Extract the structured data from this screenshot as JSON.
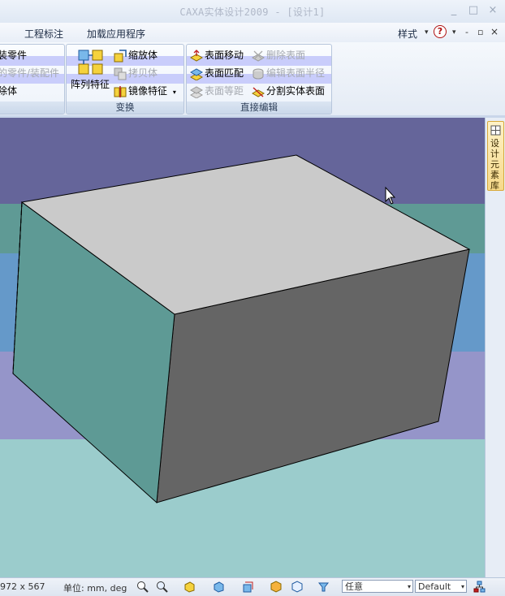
{
  "window": {
    "title": "CAXA实体设计2009 - [设计1]",
    "minimize": "_",
    "restore": "□",
    "close": "×"
  },
  "menu": {
    "tabs": [
      "工程标注",
      "加载应用程序"
    ],
    "style": "样式",
    "style_arrow": "▾",
    "help": "?",
    "help_arrow": "▾",
    "mdi_min": "-",
    "mdi_restore": "▫",
    "mdi_close": "×"
  },
  "ribbon": {
    "group1": {
      "items": [
        "装零件",
        "的零件/装配件",
        "除体"
      ]
    },
    "transform": {
      "label": "变换",
      "array_feature": "阵列特征",
      "scale_body": "缩放体",
      "copy_body": "拷贝体",
      "mirror_feature": "镜像特征",
      "mirror_arrow": "▾"
    },
    "direct_edit": {
      "label": "直接编辑",
      "surface_move": "表面移动",
      "delete_surface": "删除表面",
      "surface_match": "表面匹配",
      "edit_surface_radius": "编辑表面半径",
      "surface_offset": "表面等距",
      "split_solid_surface": "分割实体表面"
    }
  },
  "side_panel": {
    "tab_label": "设计元素库"
  },
  "canvas": {
    "background_bands": [
      "#65659a",
      "#5f9a95",
      "#6599c9",
      "#9595c9",
      "#9bcccc"
    ],
    "box_top_color": "#cacaca",
    "box_front_color": "#5e9a95",
    "box_right_color": "#656565"
  },
  "status": {
    "size": "972 x 567",
    "unit": "单位: mm, deg",
    "filter_value": "任意",
    "render_value": "Default",
    "dropdown_arrow": "▾"
  }
}
